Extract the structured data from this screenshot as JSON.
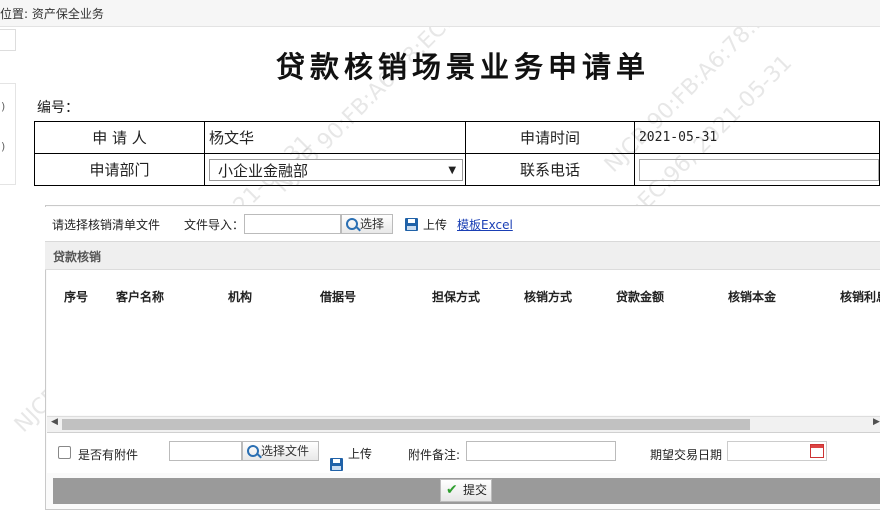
{
  "breadcrumb": {
    "text": "位置: 资产保全业务"
  },
  "side": {
    "paren1": ")",
    "paren2": ")"
  },
  "form": {
    "title": "贷款核销场景业务申请单",
    "code_label": "编号：",
    "applicant_label": "申 请 人",
    "applicant_value": "杨文华",
    "apply_time_label": "申请时间",
    "apply_time_value": "2021-05-31",
    "department_label": "申请部门",
    "department_value": "小企业金融部",
    "phone_label": "联系电话",
    "phone_value": ""
  },
  "upload": {
    "prompt": "请选择核销清单文件",
    "import_label": "文件导入：",
    "choose_label": "选择",
    "upload_label": "上传",
    "template_link": "模板Excel"
  },
  "section": {
    "title": "贷款核销"
  },
  "grid": {
    "columns": [
      "序号",
      "客户名称",
      "机构",
      "借据号",
      "担保方式",
      "核销方式",
      "贷款金额",
      "核销本金",
      "核销利息"
    ],
    "rows": []
  },
  "attach": {
    "has_attachment_label": "是否有附件",
    "has_attachment_checked": false,
    "choose_file_label": "选择文件",
    "upload_label": "上传",
    "remark_label": "附件备注:",
    "remark_value": "",
    "trade_date_label": "期望交易日期",
    "trade_date_value": ""
  },
  "submit": {
    "label": "提交"
  },
  "watermark": {
    "text": "NJCB  90:FB:A6:78:EC:96,  2021-05-31"
  }
}
